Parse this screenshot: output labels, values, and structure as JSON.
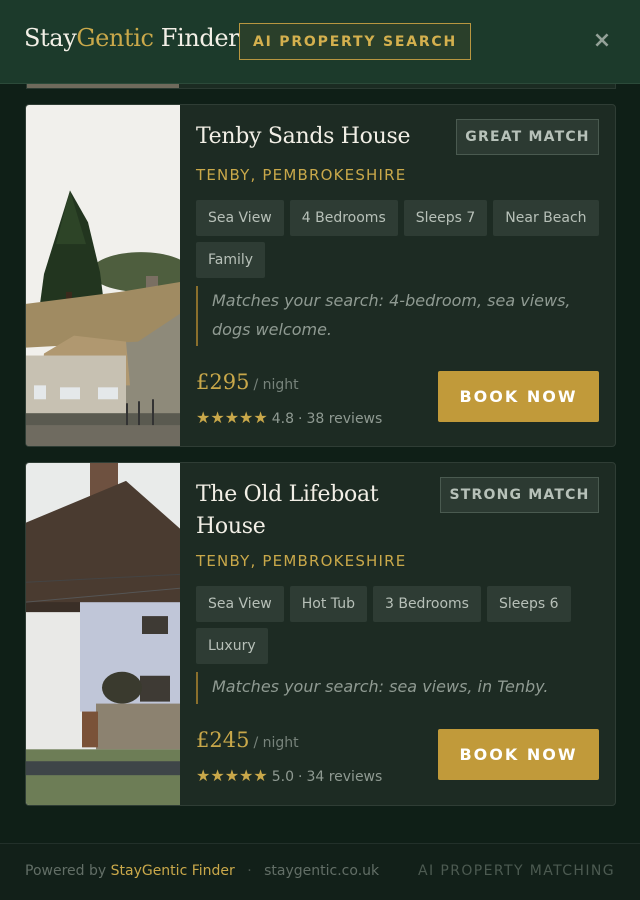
{
  "header": {
    "brand_part1": "Stay",
    "brand_part2": "Gentic",
    "brand_part3": " Finder",
    "badge": "AI PROPERTY SEARCH",
    "close_symbol": "×"
  },
  "listings": [
    {
      "title": "Tenby Sands House",
      "match": "GREAT MATCH",
      "location": "TENBY, PEMBROKESHIRE",
      "tags": [
        "Sea View",
        "4 Bedrooms",
        "Sleeps 7",
        "Near Beach",
        "Family"
      ],
      "snippet": "Matches your search: 4-bedroom, sea views, dogs welcome.",
      "price": "£295",
      "price_unit": "/ night",
      "stars": "★★★★★",
      "rating": "4.8",
      "separator": "·",
      "reviews": "38 reviews",
      "cta": "BOOK NOW"
    },
    {
      "title": "The Old Lifeboat House",
      "match": "STRONG MATCH",
      "location": "TENBY, PEMBROKESHIRE",
      "tags": [
        "Sea View",
        "Hot Tub",
        "3 Bedrooms",
        "Sleeps 6",
        "Luxury"
      ],
      "snippet": "Matches your search: sea views, in Tenby.",
      "price": "£245",
      "price_unit": "/ night",
      "stars": "★★★★★",
      "rating": "5.0",
      "separator": "·",
      "reviews": "34 reviews",
      "cta": "BOOK NOW"
    }
  ],
  "footer": {
    "powered_by": "Powered by",
    "brand": "StayGentic Finder",
    "separator": "·",
    "domain": "staygentic.co.uk",
    "tagline": "AI PROPERTY MATCHING"
  },
  "colors": {
    "background": "#0f1f17",
    "header": "#1c3a2b",
    "card": "#1d2b23",
    "gold": "#c9a84a",
    "button": "#c19a3a"
  }
}
